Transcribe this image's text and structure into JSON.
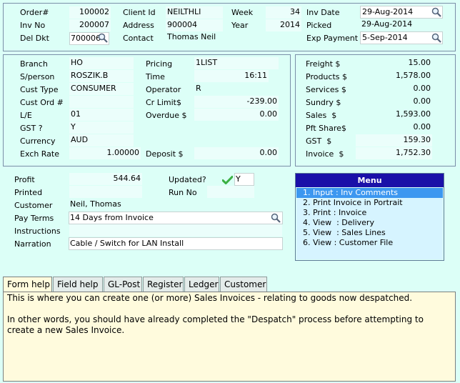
{
  "header": {
    "order_label": "Order#",
    "order_value": "100002",
    "inv_no_label": "Inv No",
    "inv_no_value": "200007",
    "del_dkt_label": "Del Dkt",
    "del_dkt_value": "700006",
    "client_id_label": "Client Id",
    "client_id_value": "NEILTHLI",
    "address_label": "Address",
    "address_value": "900004",
    "contact_label": "Contact",
    "contact_value": "Thomas Neil",
    "week_label": "Week",
    "week_value": "34",
    "year_label": "Year",
    "year_value": "2014",
    "inv_date_label": "Inv Date",
    "inv_date_value": "29-Aug-2014",
    "picked_label": "Picked",
    "picked_value": "29-Aug-2014",
    "exp_payment_label": "Exp Payment",
    "exp_payment_value": "5-Sep-2014"
  },
  "details": {
    "branch_label": "Branch",
    "branch_value": "HO",
    "sperson_label": "S/person",
    "sperson_value": "ROSZIK.B",
    "cust_type_label": "Cust Type",
    "cust_type_value": "CONSUMER",
    "cust_ord_label": "Cust Ord #",
    "cust_ord_value": "",
    "le_label": "L/E",
    "le_value": "01",
    "gst_label": "GST ?",
    "gst_value": "Y",
    "currency_label": "Currency",
    "currency_value": "AUD",
    "exch_rate_label": "Exch Rate",
    "exch_rate_value": "1.00000",
    "pricing_label": "Pricing",
    "pricing_value": "1LIST",
    "time_label": "Time",
    "time_value": "16:11",
    "operator_label": "Operator",
    "operator_value": "R",
    "cr_limit_label": "Cr Limit$",
    "cr_limit_value": "-239.00",
    "overdue_label": "Overdue $",
    "overdue_value": "0.00",
    "deposit_label": "Deposit $",
    "deposit_value": "0.00"
  },
  "totals": {
    "freight_label": "Freight $",
    "freight_value": "15.00",
    "products_label": "Products $",
    "products_value": "1,578.00",
    "services_label": "Services $",
    "services_value": "0.00",
    "sundry_label": "Sundry $",
    "sundry_value": "0.00",
    "sales_label": "Sales  $",
    "sales_value": "1,593.00",
    "pft_share_label": "Pft Share$",
    "pft_share_value": "0.00",
    "gst_label": "GST  $",
    "gst_value": "159.30",
    "invoice_label": "Invoice  $",
    "invoice_value": "1,752.30"
  },
  "lower": {
    "profit_label": "Profit",
    "profit_value": "544.64",
    "printed_label": "Printed",
    "printed_value": "",
    "updated_label": "Updated?",
    "updated_value": "Y",
    "run_no_label": "Run No",
    "run_no_value": "",
    "customer_label": "Customer",
    "customer_value": "Neil, Thomas",
    "pay_terms_label": "Pay Terms",
    "pay_terms_value": "14 Days from Invoice",
    "instructions_label": "Instructions",
    "instructions_value": "",
    "narration_label": "Narration",
    "narration_value": "Cable / Switch for LAN Install"
  },
  "menu": {
    "title": "Menu",
    "items": [
      "1. Input : Inv Comments",
      "2. Print Invoice in Portrait",
      "3. Print : Invoice",
      "4. View  : Delivery",
      "5. View  : Sales Lines",
      "6. View : Customer File"
    ]
  },
  "tabs": [
    "Form help",
    "Field help",
    "GL-Post",
    "Register",
    "Ledger",
    "Customer"
  ],
  "help": {
    "line1": "This is where you can create one (or more) Sales Invoices - relating to goods now despatched.",
    "line2": "In other words, you should have already completed the \"Despatch\" process before attempting to create a new Sales Invoice."
  },
  "colors": {
    "background": "#dcfff7",
    "menu_title": "#1a10a8",
    "menu_selected": "#3c97f0",
    "help_background": "#fffbdd",
    "check": "#3cb043"
  },
  "icons": {
    "lookup": "magnifier-icon",
    "updated": "checkmark-icon"
  }
}
